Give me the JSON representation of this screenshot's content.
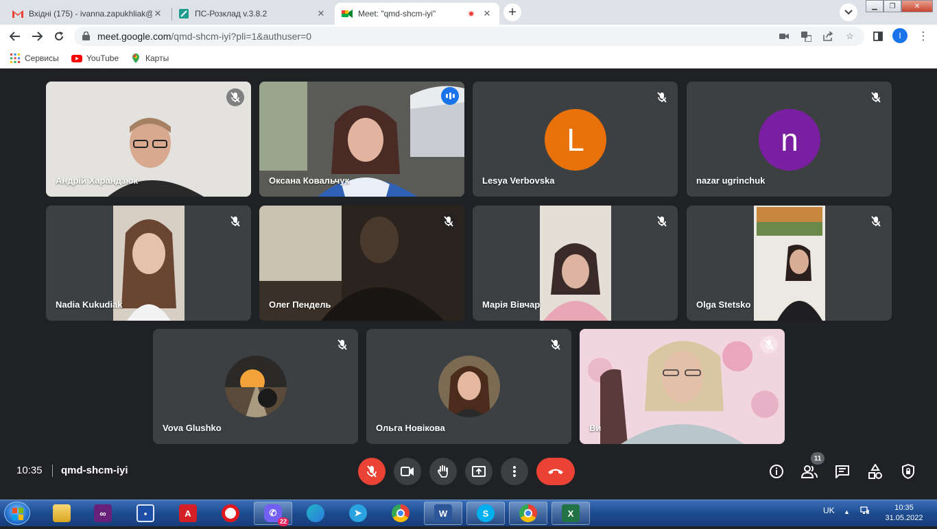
{
  "browser": {
    "tabs": [
      {
        "title": "Вхідні (175) - ivanna.zapukhliak@",
        "favicon": "gmail-icon"
      },
      {
        "title": "ПС-Розклад v.3.8.2",
        "favicon": "ps-icon"
      },
      {
        "title": "Meet: \"qmd-shcm-iyi\"",
        "favicon": "meet-icon",
        "active": true
      }
    ],
    "url_host": "meet.google.com",
    "url_path": "/qmd-shcm-iyi?pli=1&authuser=0",
    "profile_initial": "I",
    "bookmarks": [
      {
        "label": "Сервисы",
        "icon": "apps-grid-icon"
      },
      {
        "label": "YouTube",
        "icon": "youtube-icon"
      },
      {
        "label": "Карты",
        "icon": "maps-icon"
      }
    ]
  },
  "meet": {
    "participants": [
      {
        "name": "Андрій Харандзюк",
        "kind": "video",
        "muted": true
      },
      {
        "name": "Оксана Ковальчук",
        "kind": "video",
        "speaking": true
      },
      {
        "name": "Lesya Verbovska",
        "kind": "avatar",
        "initial": "L",
        "color": "#e8710a",
        "muted": true
      },
      {
        "name": "nazar ugrinchuk",
        "kind": "avatar",
        "initial": "n",
        "color": "#7b1fa2",
        "muted": true
      },
      {
        "name": "Nadia Kukudiak",
        "kind": "video",
        "muted": true
      },
      {
        "name": "Олег Пендель",
        "kind": "video",
        "muted": true
      },
      {
        "name": "Марія Вівчар",
        "kind": "video",
        "muted": true
      },
      {
        "name": "Olga Stetsko",
        "kind": "video",
        "muted": true
      },
      {
        "name": "Vova Glushko",
        "kind": "photo",
        "muted": true
      },
      {
        "name": "Ольга Новікова",
        "kind": "photo",
        "muted": true
      },
      {
        "name": "Ви",
        "kind": "video",
        "muted": true
      }
    ],
    "time": "10:35",
    "meeting_code": "qmd-shcm-iyi",
    "people_count": "11",
    "colors": {
      "end_call": "#ea4335",
      "speaking_outline": "#8ab4f8",
      "accent": "#1a73e8"
    }
  },
  "taskbar": {
    "viber_badge": "22",
    "language": "UK",
    "time": "10:35",
    "date": "31.05.2022"
  }
}
